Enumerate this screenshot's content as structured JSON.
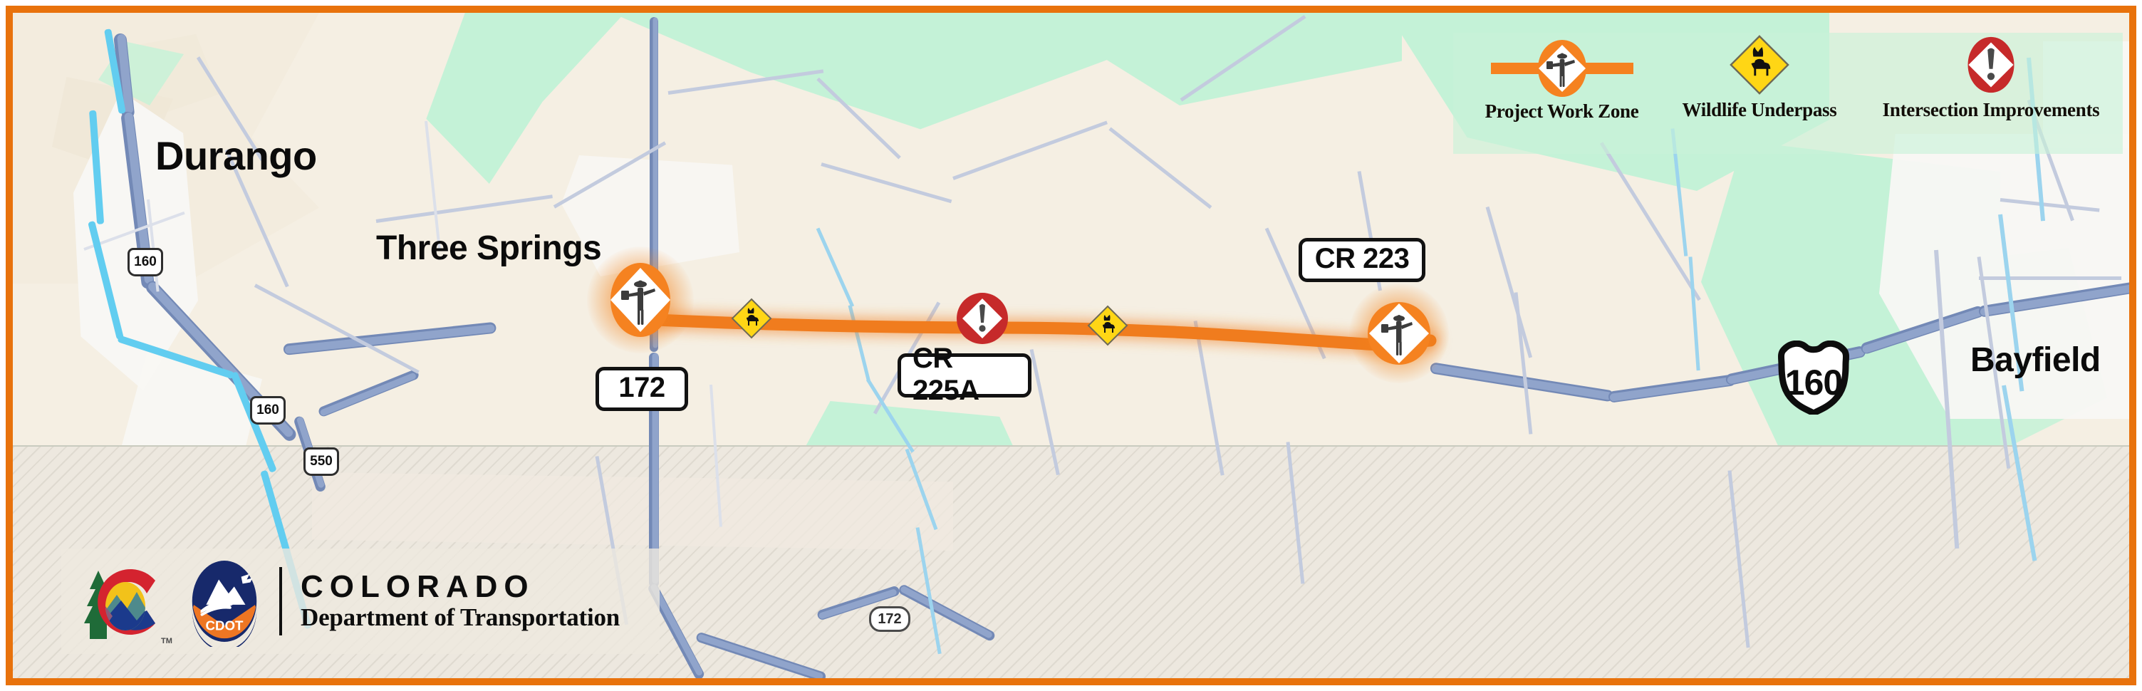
{
  "frame": {
    "border_color": "#E8720C",
    "background": "#F5EFE3"
  },
  "map": {
    "background_color": "#F5EFE3",
    "forest_color": "#C4F2D7",
    "reservation_hatch_color": "#EDE8DF",
    "highway_color": "#90A4CB",
    "river_color": "#62CDF0",
    "corridor_color": "#F07C1E"
  },
  "places": [
    {
      "name": "Durango",
      "label": "Durango"
    },
    {
      "name": "Three Springs",
      "label": "Three Springs"
    },
    {
      "name": "Bayfield",
      "label": "Bayfield"
    }
  ],
  "shields": {
    "us160_large": "160",
    "small": [
      {
        "label": "160",
        "type": "us"
      },
      {
        "label": "160",
        "type": "us"
      },
      {
        "label": "550",
        "type": "us"
      },
      {
        "label": "172",
        "type": "state"
      }
    ]
  },
  "plates": [
    {
      "name": "sh-172-plate",
      "label": "172"
    },
    {
      "name": "cr-225a-plate",
      "label": "CR 225A"
    },
    {
      "name": "cr-223-plate",
      "label": "CR 223"
    }
  ],
  "markers": [
    {
      "name": "work-zone-west",
      "type": "work-zone",
      "label": "Project Work Zone"
    },
    {
      "name": "wildlife-underpass-west",
      "type": "wildlife",
      "label": "Wildlife Underpass"
    },
    {
      "name": "intersection-improvement-cr225a",
      "type": "intersection",
      "label": "Intersection Improvements"
    },
    {
      "name": "wildlife-underpass-east",
      "type": "wildlife",
      "label": "Wildlife Underpass"
    },
    {
      "name": "work-zone-east",
      "type": "work-zone",
      "label": "Project Work Zone"
    }
  ],
  "legend": {
    "items": [
      {
        "icon": "work-zone-icon",
        "label": "Project Work Zone"
      },
      {
        "icon": "wildlife-crossing-icon",
        "label": "Wildlife Underpass"
      },
      {
        "icon": "intersection-warning-icon",
        "label": "Intersection Improvements"
      }
    ]
  },
  "logo": {
    "agency_line1": "COLORADO",
    "agency_line2": "Department of Transportation",
    "badge_text": "CDOT",
    "trademark": "TM"
  }
}
